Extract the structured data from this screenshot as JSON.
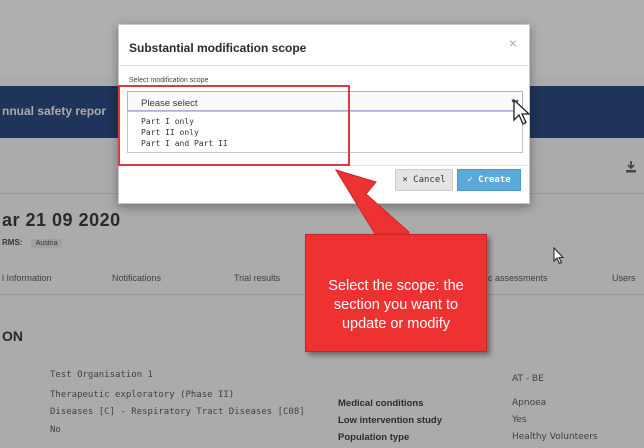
{
  "page": {
    "nav_title": "nnual safety repor",
    "trial_title": "ar 21 09 2020",
    "rms_label": "RMS:",
    "rms_value": "Austria",
    "tabs": [
      {
        "label": "l Information"
      },
      {
        "label": "Notifications"
      },
      {
        "label": "Trial results"
      },
      {
        "label": "c assessments"
      },
      {
        "label": "Users"
      }
    ],
    "section_title": "ON",
    "details_left": [
      "Test Organisation 1",
      "Therapeutic exploratory (Phase II)",
      "Diseases [C] - Respiratory Tract Diseases [C08]",
      "No"
    ],
    "details_right_labels": [
      "Medical conditions",
      "Low intervention study",
      "Population type"
    ],
    "details_right_values": [
      "AT - BE",
      "Apnoea",
      "Yes",
      "Healthy Volunteers"
    ]
  },
  "modal": {
    "title": "Substantial modification scope",
    "close_glyph": "×",
    "field_label": "Select modification scope",
    "select_value": "Please select",
    "options": [
      "Part I only",
      "Part II only",
      "Part I and Part II"
    ],
    "cancel_label": "× Cancel",
    "create_label": "✓ Create"
  },
  "callout": {
    "text": "Select the scope: the section you want to update or modify"
  },
  "colors": {
    "nav": "#1b3a72",
    "highlight": "#e0393a",
    "callout": "#ee3232",
    "create_button": "#5aa9d8"
  }
}
